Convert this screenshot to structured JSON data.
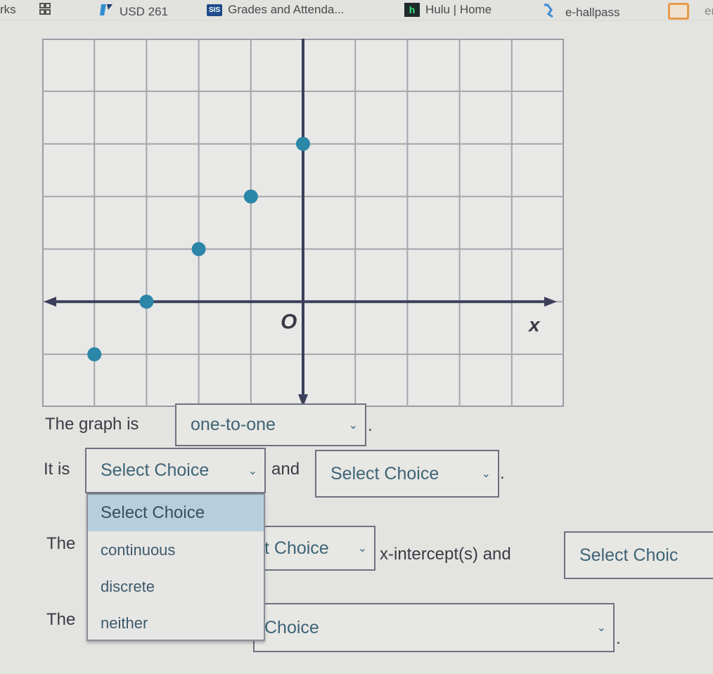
{
  "bookmarks": [
    {
      "label": "rks",
      "icon": "bookmarks-folder-icon"
    },
    {
      "label": "",
      "icon": "apps-grid-icon"
    },
    {
      "label": "USD 261",
      "icon": "usd-logo-icon"
    },
    {
      "label": "Grades and Attenda...",
      "icon": "sis-icon"
    },
    {
      "label": "Hulu | Home",
      "icon": "hulu-icon"
    },
    {
      "label": "e-hallpass",
      "icon": "ehallpass-icon"
    },
    {
      "label": "en",
      "icon": "orange-square-icon"
    }
  ],
  "chart_data": {
    "type": "scatter",
    "title": "",
    "xlabel": "x",
    "origin_label": "O",
    "xlim": [
      -5,
      5
    ],
    "ylim": [
      -3,
      6
    ],
    "grid": true,
    "points": [
      {
        "x": -4,
        "y": -1.5
      },
      {
        "x": -3,
        "y": 0
      },
      {
        "x": -2,
        "y": 1.5
      },
      {
        "x": -1,
        "y": 3
      },
      {
        "x": 0,
        "y": 4.5
      }
    ],
    "point_color": "#2b86a8"
  },
  "questions": {
    "q1_prefix": "The graph is",
    "q1_value": "one-to-one",
    "q1_suffix": ".",
    "q2_prefix": "It is",
    "q2_value1": "Select Choice",
    "q2_and": "and",
    "q2_value2": "Select Choice",
    "q2_suffix": ".",
    "q3_prefix": "The",
    "q3_value1": "t Choice",
    "q3_mid": "x-intercept(s) and",
    "q3_value2": "Select Choic",
    "q4_prefix": "The",
    "q4_value": "Choice",
    "q4_suffix": "."
  },
  "dropdown": {
    "options": [
      "Select Choice",
      "continuous",
      "discrete",
      "neither"
    ],
    "highlighted": "Select Choice"
  }
}
